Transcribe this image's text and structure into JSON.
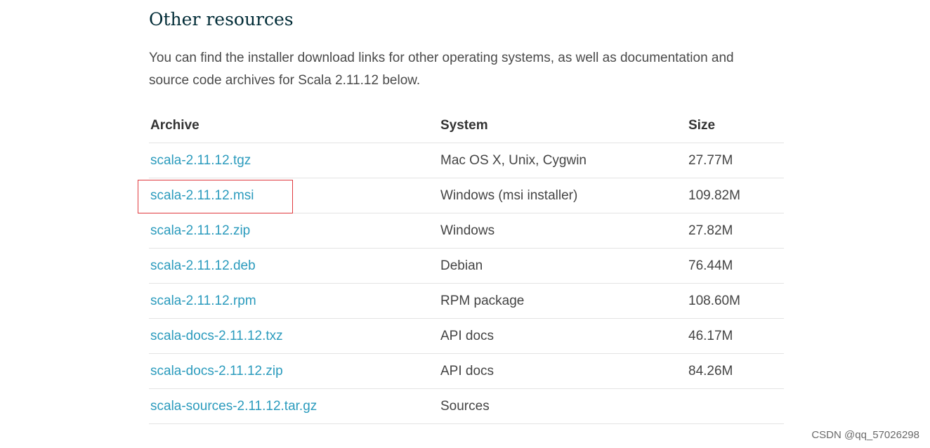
{
  "section": {
    "heading": "Other resources",
    "intro": "You can find the installer download links for other operating systems, as well as documentation and source code archives for Scala 2.11.12 below."
  },
  "table": {
    "headers": {
      "archive": "Archive",
      "system": "System",
      "size": "Size"
    },
    "rows": [
      {
        "archive": "scala-2.11.12.tgz",
        "system": "Mac OS X, Unix, Cygwin",
        "size": "27.77M"
      },
      {
        "archive": "scala-2.11.12.msi",
        "system": "Windows (msi installer)",
        "size": "109.82M"
      },
      {
        "archive": "scala-2.11.12.zip",
        "system": "Windows",
        "size": "27.82M"
      },
      {
        "archive": "scala-2.11.12.deb",
        "system": "Debian",
        "size": "76.44M"
      },
      {
        "archive": "scala-2.11.12.rpm",
        "system": "RPM package",
        "size": "108.60M"
      },
      {
        "archive": "scala-docs-2.11.12.txz",
        "system": "API docs",
        "size": "46.17M"
      },
      {
        "archive": "scala-docs-2.11.12.zip",
        "system": "API docs",
        "size": "84.26M"
      },
      {
        "archive": "scala-sources-2.11.12.tar.gz",
        "system": "Sources",
        "size": ""
      }
    ]
  },
  "watermark": "CSDN @qq_57026298",
  "colors": {
    "link": "#2b9bbd",
    "heading": "#002b36",
    "highlight_box": "#e0393e",
    "row_divider": "#e3e3e3"
  }
}
